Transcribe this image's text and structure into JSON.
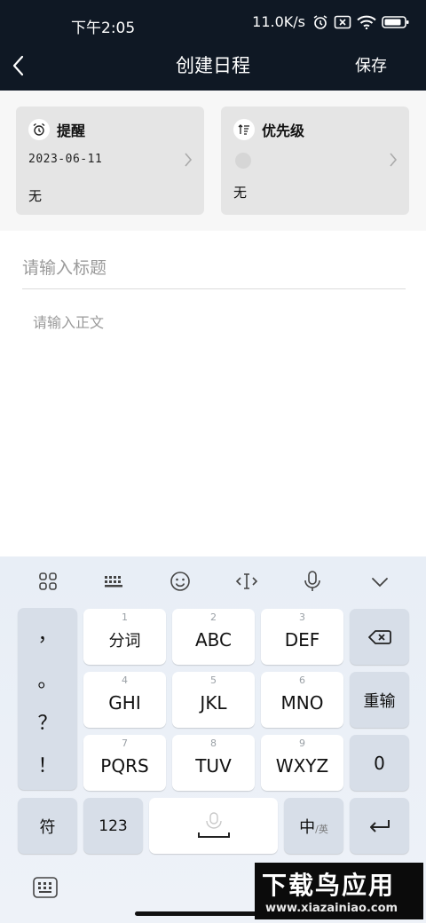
{
  "status_bar": {
    "time": "下午2:05",
    "net_speed": "11.0K/s"
  },
  "header": {
    "title": "创建日程",
    "save_label": "保存"
  },
  "reminder_card": {
    "label": "提醒",
    "date": "2023-06-11",
    "value": "无"
  },
  "priority_card": {
    "label": "优先级",
    "value": "无"
  },
  "form": {
    "title_placeholder": "请输入标题",
    "body_placeholder": "请输入正文"
  },
  "keyboard": {
    "toolbar_icons": [
      "apps-grid-icon",
      "keyboard-icon",
      "emoji-icon",
      "text-cursor-icon",
      "microphone-icon",
      "collapse-chevron-icon"
    ],
    "punctuation": [
      "，",
      "。",
      "？",
      "！"
    ],
    "keys": [
      {
        "num": "1",
        "label": "分词"
      },
      {
        "num": "2",
        "label": "ABC"
      },
      {
        "num": "3",
        "label": "DEF"
      },
      {
        "num": "4",
        "label": "GHI"
      },
      {
        "num": "5",
        "label": "JKL"
      },
      {
        "num": "6",
        "label": "MNO"
      },
      {
        "num": "7",
        "label": "PQRS"
      },
      {
        "num": "8",
        "label": "TUV"
      },
      {
        "num": "9",
        "label": "WXYZ"
      }
    ],
    "retype_label": "重输",
    "zero_label": "0",
    "symbol_label": "符",
    "num123_label": "123",
    "lang_label": "中",
    "lang_sub_label": "/英"
  },
  "watermark": {
    "title": "下载鸟应用",
    "url": "www.xiazainiao.com"
  }
}
